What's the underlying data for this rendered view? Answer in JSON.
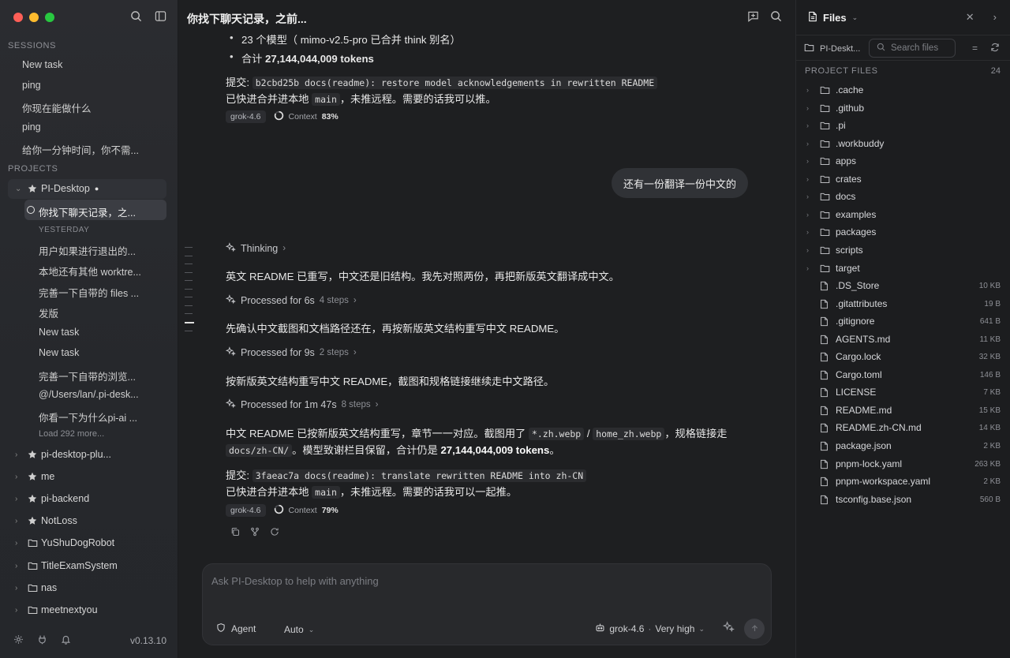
{
  "sidebar": {
    "sessions_label": "SESSIONS",
    "sessions": [
      "New task",
      "ping",
      "你现在能做什么",
      "ping",
      "给你一分钟时间，你不需..."
    ],
    "projects_label": "PROJECTS",
    "active_project": "PI-Desktop",
    "active_task": "你找下聊天记录，之...",
    "yesterday_label": "YESTERDAY",
    "tasks": [
      "用户如果进行退出的...",
      "本地还有其他 worktre...",
      "完善一下自带的 files ...",
      "发版",
      "New task",
      "New task",
      "完善一下自带的浏览...",
      "@/Users/lan/.pi-desk...",
      "你看一下为什么pi-ai ..."
    ],
    "load_more": "Load 292 more...",
    "projects": [
      {
        "label": "pi-desktop-plu...",
        "icon": "star"
      },
      {
        "label": "me",
        "icon": "star"
      },
      {
        "label": "pi-backend",
        "icon": "star"
      },
      {
        "label": "NotLoss",
        "icon": "star"
      },
      {
        "label": "YuShuDogRobot",
        "icon": "folder"
      },
      {
        "label": "TitleExamSystem",
        "icon": "folder"
      },
      {
        "label": "nas",
        "icon": "folder"
      },
      {
        "label": "meetnextyou",
        "icon": "folder"
      }
    ],
    "version": "v0.13.10"
  },
  "main": {
    "title": "你找下聊天记录，之前...",
    "bullet1": "23 个模型（ mimo-v2.5-pro 已合并 think 别名）",
    "bullet2_prefix": "合计 ",
    "bullet2_bold": "27,144,044,009 tokens",
    "commit1_label": "提交:",
    "commit1_code": "b2cbd25b docs(readme): restore model acknowledgements in rewritten README",
    "merge1_a": "已快进合并进本地",
    "merge1_code": "main",
    "merge1_b": "，未推远程。需要的话我可以推。",
    "model1": "grok-4.6",
    "ctx_label": "Context",
    "ctx1": "83%",
    "user_msg": "还有一份翻译一份中文的",
    "thinking": "Thinking",
    "p1": "英文 README 已重写，中文还是旧结构。我先对照两份，再把新版英文翻译成中文。",
    "step1": "Processed for 6s",
    "step1_dim": "4 steps",
    "p2": "先确认中文截图和文档路径还在，再按新版英文结构重写中文 README。",
    "step2": "Processed for 9s",
    "step2_dim": "2 steps",
    "p3": "按新版英文结构重写中文 README，截图和规格链接继续走中文路径。",
    "step3": "Processed for 1m 47s",
    "step3_dim": "8 steps",
    "p4_a": "中文 README 已按新版英文结构重写，章节一一对应。截图用了",
    "p4_code1": "*.zh.webp",
    "p4_slash": "/",
    "p4_code2": "home_zh.webp",
    "p4_b": "，规格链接走",
    "p4_code3": "docs/zh-CN/",
    "p4_c": "。模型致谢栏目保留，合计仍是",
    "p4_bold": "27,144,044,009 tokens",
    "p4_d": "。",
    "commit2_label": "提交:",
    "commit2_code": "3faeac7a docs(readme): translate rewritten README into zh-CN",
    "merge2_a": "已快进合并进本地",
    "merge2_code": "main",
    "merge2_b": "，未推远程。需要的话我可以一起推。",
    "model2": "grok-4.6",
    "ctx2": "79%"
  },
  "composer": {
    "placeholder": "Ask PI-Desktop to help with anything",
    "agent": "Agent",
    "mode": "Auto",
    "model": "grok-4.6",
    "dot": "·",
    "effort": "Very high"
  },
  "files": {
    "title": "Files",
    "crumb": "PI-Deskt...",
    "search_placeholder": "Search files",
    "section": "PROJECT FILES",
    "count": "24",
    "folders": [
      ".cache",
      ".github",
      ".pi",
      ".workbuddy",
      "apps",
      "crates",
      "docs",
      "examples",
      "packages",
      "scripts",
      "target"
    ],
    "file_list": [
      {
        "name": ".DS_Store",
        "size": "10 KB"
      },
      {
        "name": ".gitattributes",
        "size": "19 B"
      },
      {
        "name": ".gitignore",
        "size": "641 B"
      },
      {
        "name": "AGENTS.md",
        "size": "11 KB"
      },
      {
        "name": "Cargo.lock",
        "size": "32 KB"
      },
      {
        "name": "Cargo.toml",
        "size": "146 B"
      },
      {
        "name": "LICENSE",
        "size": "7 KB"
      },
      {
        "name": "README.md",
        "size": "15 KB"
      },
      {
        "name": "README.zh-CN.md",
        "size": "14 KB"
      },
      {
        "name": "package.json",
        "size": "2 KB"
      },
      {
        "name": "pnpm-lock.yaml",
        "size": "263 KB"
      },
      {
        "name": "pnpm-workspace.yaml",
        "size": "2 KB"
      },
      {
        "name": "tsconfig.base.json",
        "size": "560 B"
      }
    ]
  }
}
